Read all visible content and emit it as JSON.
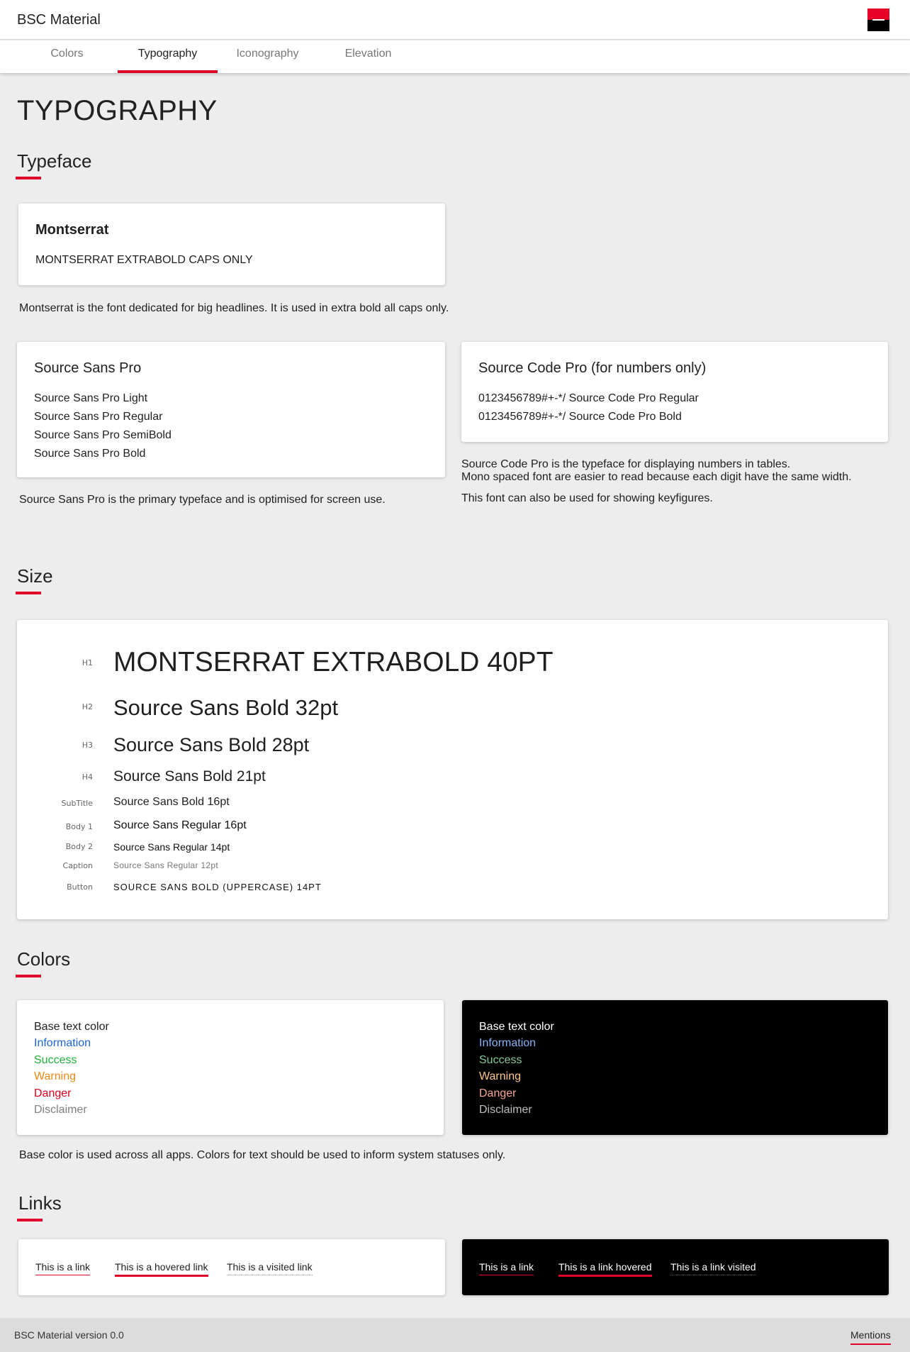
{
  "app": {
    "title": "BSC Material"
  },
  "tabs": [
    {
      "label": "Colors"
    },
    {
      "label": "Typography"
    },
    {
      "label": "Iconography"
    },
    {
      "label": "Elevation"
    }
  ],
  "page": {
    "title": "TYPOGRAPHY",
    "typeface": {
      "heading": "Typeface",
      "montserrat": {
        "name": "Montserrat",
        "sample": "MONTSERRAT EXTRABOLD CAPS ONLY",
        "description": "Montserrat is the font dedicated for big headlines. It is used in extra bold all caps only."
      },
      "source_sans": {
        "name": "Source Sans Pro",
        "weights": [
          "Source Sans Pro Light",
          "Source Sans Pro Regular",
          "Source Sans Pro SemiBold",
          "Source Sans Pro Bold"
        ],
        "description": "Source Sans Pro is the primary typeface and is optimised for screen use."
      },
      "source_code": {
        "name": "Source Code Pro (for numbers only)",
        "samples": [
          "0123456789#+-*/ Source Code Pro Regular",
          "0123456789#+-*/ Source Code Pro Bold"
        ],
        "description_1": "Source Code Pro is the typeface for displaying numbers in tables.",
        "description_2": "Mono spaced font are easier to read because each digit have the same width.",
        "description_3": "This font can also be used for showing keyfigures."
      }
    },
    "size": {
      "heading": "Size",
      "rows": [
        {
          "label": "H1",
          "sample": "MONTSERRAT EXTRABOLD 40PT"
        },
        {
          "label": "H2",
          "sample": "Source Sans Bold 32pt"
        },
        {
          "label": "H3",
          "sample": "Source Sans Bold 28pt"
        },
        {
          "label": "H4",
          "sample": "Source Sans Bold 21pt"
        },
        {
          "label": "SubTitle",
          "sample": "Source Sans Bold 16pt"
        },
        {
          "label": "Body 1",
          "sample": "Source Sans Regular 16pt"
        },
        {
          "label": "Body 2",
          "sample": "Source Sans Regular 14pt"
        },
        {
          "label": "Caption",
          "sample": "Source Sans Regular 12pt"
        },
        {
          "label": "Button",
          "sample": "SOURCE SANS BOLD (UPPERCASE) 14PT"
        }
      ]
    },
    "colors": {
      "heading": "Colors",
      "light": [
        {
          "label": "Base text color",
          "color": "#1f1f1f"
        },
        {
          "label": "Information",
          "color": "#1c64d8"
        },
        {
          "label": "Success",
          "color": "#1fb23a"
        },
        {
          "label": "Warning",
          "color": "#e88a17"
        },
        {
          "label": "Danger",
          "color": "#e0001c"
        },
        {
          "label": "Disclaimer",
          "color": "#808080"
        }
      ],
      "dark": [
        {
          "label": "Base text color",
          "color": "#ffffff"
        },
        {
          "label": "Information",
          "color": "#8ab4f8"
        },
        {
          "label": "Success",
          "color": "#81c995"
        },
        {
          "label": "Warning",
          "color": "#fdc68b"
        },
        {
          "label": "Danger",
          "color": "#f6a596"
        },
        {
          "label": "Disclaimer",
          "color": "#bdbdbd"
        }
      ],
      "description": "Base color is used across all apps. Colors for text should be used to inform system statuses only."
    },
    "links": {
      "heading": "Links",
      "light": [
        "This is a link",
        "This is a hovered link",
        "This is a visited link"
      ],
      "dark": [
        "This is a link",
        "This is a link hovered",
        "This is a link visited"
      ]
    }
  },
  "footer": {
    "version": "BSC Material version 0.0",
    "mentions": "Mentions"
  },
  "theme": {
    "accent": "#e0002a"
  }
}
